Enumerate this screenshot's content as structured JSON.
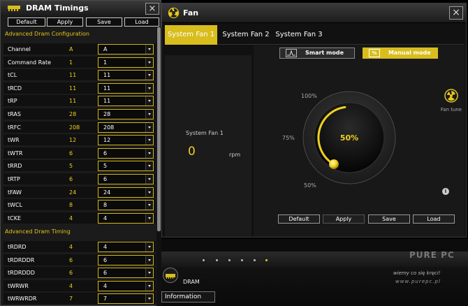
{
  "colors": {
    "accent": "#d8bd1d",
    "value_yellow": "#f1d01f",
    "window_bg": "#1b1b1b"
  },
  "dram": {
    "title": "DRAM Timings",
    "close": "×",
    "buttons": {
      "default": "Default",
      "apply": "Apply",
      "save": "Save",
      "load": "Load"
    },
    "section_config": "Advanced Dram Configuration",
    "section_timing": "Advanced Dram Timing",
    "config_rows": [
      {
        "label": "Channel",
        "value": "A",
        "select": "A"
      },
      {
        "label": "Command Rate",
        "value": "1",
        "select": "1"
      },
      {
        "label": "tCL",
        "value": "11",
        "select": "11"
      },
      {
        "label": "tRCD",
        "value": "11",
        "select": "11"
      },
      {
        "label": "tRP",
        "value": "11",
        "select": "11"
      },
      {
        "label": "tRAS",
        "value": "28",
        "select": "28"
      },
      {
        "label": "tRFC",
        "value": "208",
        "select": "208"
      },
      {
        "label": "tWR",
        "value": "12",
        "select": "12"
      },
      {
        "label": "tWTR",
        "value": "6",
        "select": "6"
      },
      {
        "label": "tRRD",
        "value": "5",
        "select": "5"
      },
      {
        "label": "tRTP",
        "value": "6",
        "select": "6"
      },
      {
        "label": "tFAW",
        "value": "24",
        "select": "24"
      },
      {
        "label": "tWCL",
        "value": "8",
        "select": "8"
      },
      {
        "label": "tCKE",
        "value": "4",
        "select": "4"
      }
    ],
    "timing_rows": [
      {
        "label": "tRDRD",
        "value": "4",
        "select": "4"
      },
      {
        "label": "tRDRDDR",
        "value": "6",
        "select": "6"
      },
      {
        "label": "tRDRDDD",
        "value": "6",
        "select": "6"
      },
      {
        "label": "tWRWR",
        "value": "4",
        "select": "4"
      },
      {
        "label": "tWRWRDR",
        "value": "7",
        "select": "7"
      }
    ]
  },
  "fan": {
    "title": "Fan",
    "close": "×",
    "tabs": [
      "System Fan 1",
      "System Fan 2",
      "System Fan 3"
    ],
    "left": {
      "name": "System Fan 1",
      "value": "0",
      "unit": "rpm"
    },
    "modes": {
      "smart": "Smart mode",
      "manual": "Manual mode"
    },
    "dial": {
      "top": "100%",
      "mid": "75%",
      "bottom": "50%",
      "value": "50%",
      "level_percent": 50
    },
    "fan_tune": "Fan tune",
    "info": "i",
    "buttons": {
      "default": "Default",
      "apply": "Apply",
      "save": "Save",
      "load": "Load"
    }
  },
  "bottom": {
    "dram_label": "DRAM",
    "info_label": "Information",
    "wm_name": "PURE PC",
    "wm_slogan": "wiemy co się kręci!",
    "wm_url": "www.purepc.pl"
  }
}
